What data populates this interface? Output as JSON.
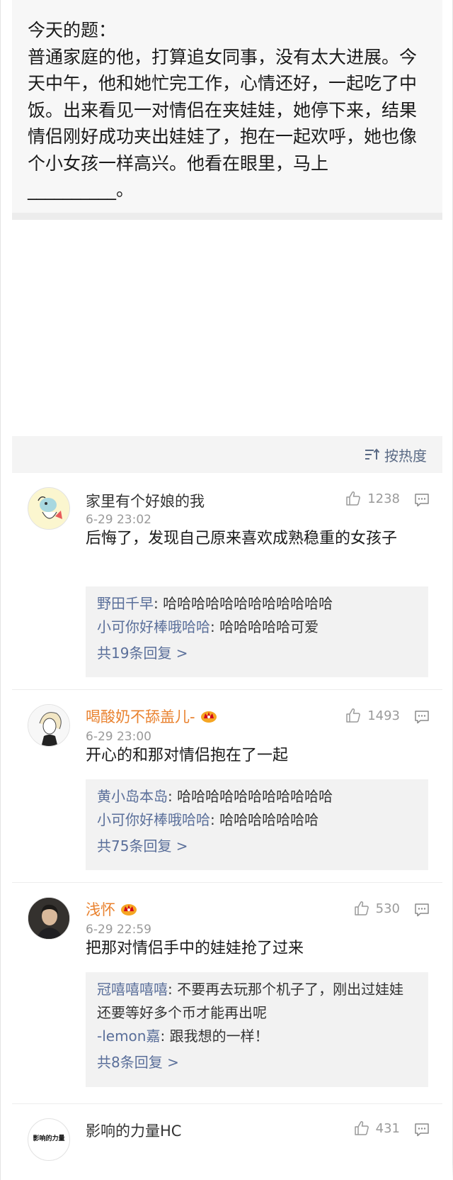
{
  "post": {
    "text": "今天的题：\n普通家庭的他，打算追女同事，没有太大进展。今天中午，他和她忙完工作，心情还好，一起吃了中饭。出来看见一对情侣在夹娃娃，她停下来，结果情侣刚好成功夹出娃娃了，抱在一起欢呼，她也像个小女孩一样高兴。他看在眼里，马上 __________。"
  },
  "sort": {
    "label": "按热度",
    "icon": "sort-icon"
  },
  "colors": {
    "gold_name": "#e9822f",
    "link": "#5a6f9a",
    "sort_text": "#5a6a85",
    "vip_crown": "#f5a623"
  },
  "comments": [
    {
      "name": "家里有个好娘的我",
      "time": "6-29 23:02",
      "likes": "1238",
      "body": "后悔了，发现自己原来喜欢成熟稳重的女孩子",
      "replies": [
        {
          "name": "野田千早",
          "text": ": 哈哈哈哈哈哈哈哈哈哈哈哈"
        },
        {
          "name": "小可你好棒哦哈哈",
          "text": ": 哈哈哈哈哈可爱"
        }
      ],
      "more": "共19条回复 >"
    },
    {
      "name": "喝酸奶不舔盖儿-",
      "time": "6-29 23:00",
      "likes": "1493",
      "body": "开心的和那对情侣抱在了一起",
      "replies": [
        {
          "name": "黄小岛本岛",
          "text": ": 哈哈哈哈哈哈哈哈哈哈哈"
        },
        {
          "name": "小可你好棒哦哈哈",
          "text": ": 哈哈哈哈哈哈哈"
        }
      ],
      "more": "共75条回复 >"
    },
    {
      "name": "浅怀",
      "time": "6-29 22:59",
      "likes": "530",
      "body": "把那对情侣手中的娃娃抢了过来",
      "replies": [
        {
          "name": "冠嘻嘻嘻嘻",
          "text": ": 不要再去玩那个机子了，刚出过娃娃还要等好多个币才能再出呢"
        },
        {
          "name": "-lemon嘉",
          "text": ": 跟我想的一样！"
        }
      ],
      "more": "共8条回复 >"
    },
    {
      "name": "影响的力量HC",
      "likes": "431",
      "avatar_text": "影响的力量"
    }
  ]
}
